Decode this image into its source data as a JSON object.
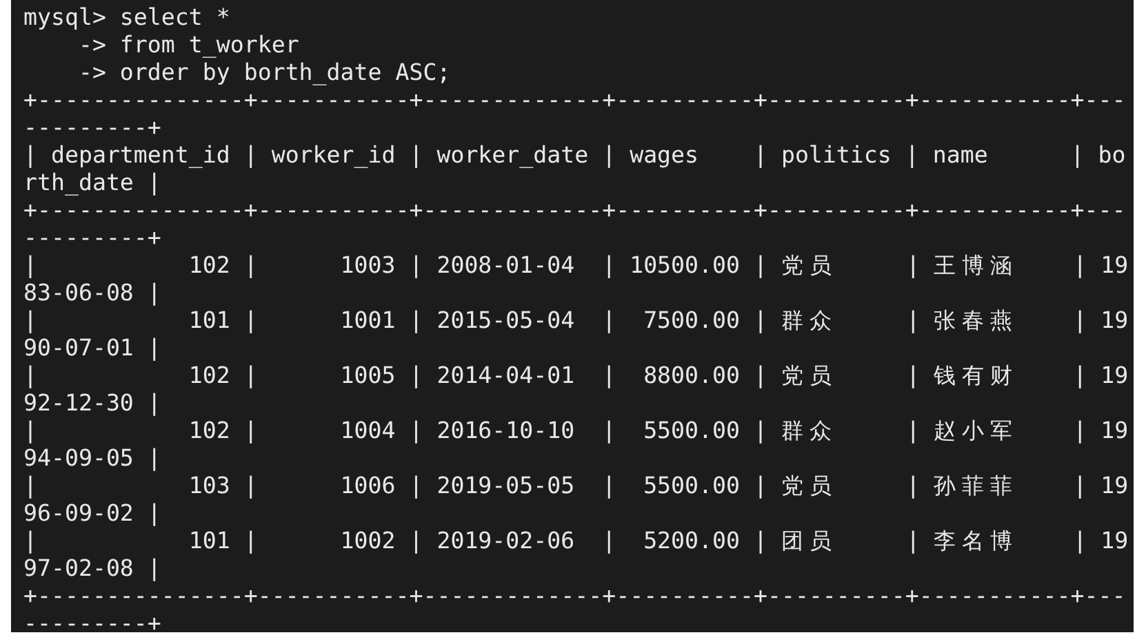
{
  "terminal": {
    "lines": [
      "mysql> select *",
      "    -> from t_worker",
      "    -> order by borth_date ASC;",
      "+---------------+-----------+-------------+----------+----------+-----------+---",
      "---------+",
      "| department_id | worker_id | worker_date | wages    | politics | name      | bo",
      "rth_date |",
      "+---------------+-----------+-------------+----------+----------+-----------+---",
      "---------+",
      "|           102 |      1003 | 2008-01-04  | 10500.00 | 党员     | 王博涵    | 19",
      "83-06-08 |",
      "|           101 |      1001 | 2015-05-04  |  7500.00 | 群众     | 张春燕    | 19",
      "90-07-01 |",
      "|           102 |      1005 | 2014-04-01  |  8800.00 | 党员     | 钱有财    | 19",
      "92-12-30 |",
      "|           102 |      1004 | 2016-10-10  |  5500.00 | 群众     | 赵小军    | 19",
      "94-09-05 |",
      "|           103 |      1006 | 2019-05-05  |  5500.00 | 党员     | 孙菲菲    | 19",
      "96-09-02 |",
      "|           101 |      1002 | 2019-02-06  |  5200.00 | 团员     | 李名博    | 19",
      "97-02-08 |",
      "+---------------+-----------+-------------+----------+----------+-----------+---",
      "---------+"
    ]
  }
}
